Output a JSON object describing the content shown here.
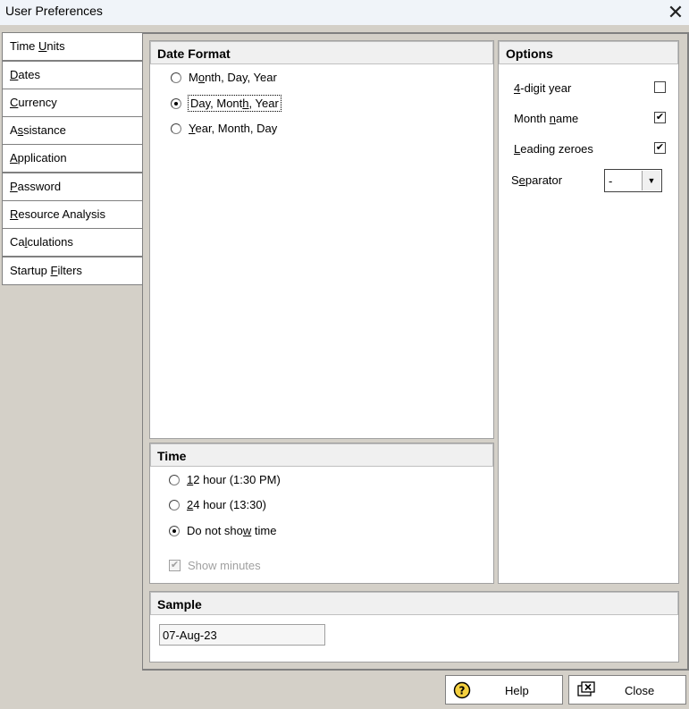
{
  "window": {
    "title": "User Preferences",
    "close_glyph": "✕"
  },
  "tabs": [
    {
      "label": "Time Units",
      "active": false
    },
    {
      "label": "Dates",
      "active": true
    },
    {
      "label": "Currency",
      "active": false
    },
    {
      "label": "Assistance",
      "active": false
    },
    {
      "label": "Application",
      "active": false
    },
    {
      "label": "Password",
      "active": false
    },
    {
      "label": "Resource Analysis",
      "active": false
    },
    {
      "label": "Calculations",
      "active": false
    },
    {
      "label": "Startup Filters",
      "active": false
    }
  ],
  "date_format": {
    "header": "Date Format",
    "options": [
      {
        "label": "Month, Day, Year",
        "selected": false
      },
      {
        "label": "Day, Month, Year",
        "selected": true
      },
      {
        "label": "Year, Month, Day",
        "selected": false
      }
    ]
  },
  "options": {
    "header": "Options",
    "four_digit_year": {
      "label": "4-digit year",
      "checked": false
    },
    "month_name": {
      "label": "Month name",
      "checked": true
    },
    "leading_zeroes": {
      "label": "Leading zeroes",
      "checked": true
    },
    "separator": {
      "label": "Separator",
      "value": "-"
    }
  },
  "time": {
    "header": "Time",
    "options": [
      {
        "label": "12 hour (1:30 PM)",
        "selected": false
      },
      {
        "label": "24 hour (13:30)",
        "selected": false
      },
      {
        "label": "Do not show time",
        "selected": true
      }
    ],
    "show_minutes": {
      "label": "Show minutes",
      "checked": true,
      "enabled": false
    }
  },
  "sample": {
    "header": "Sample",
    "value": "07-Aug-23"
  },
  "buttons": {
    "help": "Help",
    "close": "Close"
  },
  "icons": {
    "help": "question-mark-icon",
    "close": "window-close-icon"
  },
  "colors": {
    "dialog_bg": "#d4d0c8",
    "title_bg": "#f0f4f9",
    "panel_bg": "#ffffff",
    "header_bg": "#f0f0f0",
    "help_icon_fill": "#f4d03f"
  }
}
